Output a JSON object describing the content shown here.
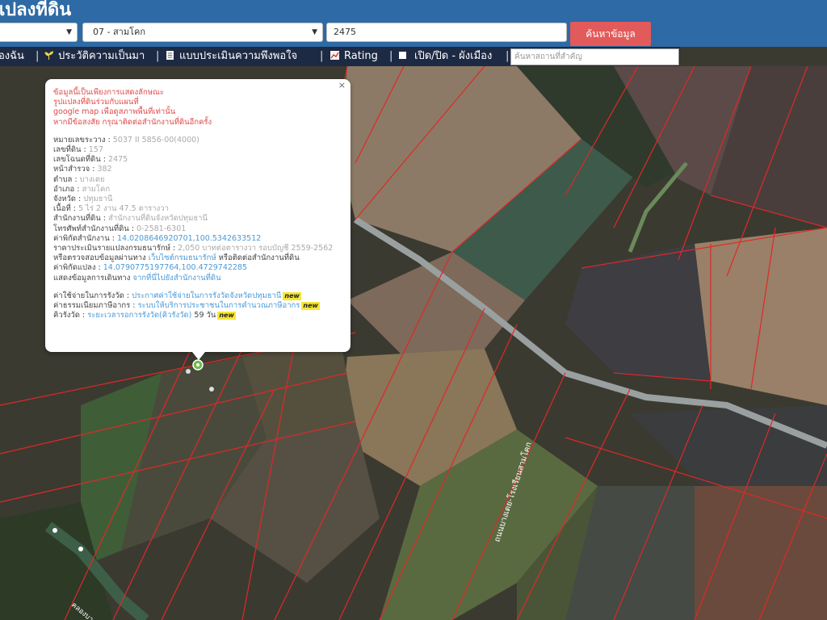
{
  "header": {
    "title": "แปลงที่ดิน",
    "province_select": {
      "value": ""
    },
    "district_select": {
      "value": "07 - สามโคก"
    },
    "parcel_input": {
      "value": "2475"
    },
    "search_button": {
      "label": "ค้นหาข้อมูล"
    }
  },
  "toolbar": {
    "items": [
      {
        "label": "องฉัน"
      },
      {
        "label": "ประวัติความเป็นมา",
        "icon": "sprout-icon"
      },
      {
        "label": "แบบประเมินความพึงพอใจ",
        "icon": "document-icon"
      },
      {
        "label": "Rating",
        "icon": "chart-icon"
      },
      {
        "label": "เปิด/ปิด - ผังเมือง",
        "icon": "checkbox-icon"
      }
    ],
    "place_search": {
      "placeholder": "ค้นหาสถานที่สำคัญ"
    }
  },
  "popup": {
    "notice": [
      "ข้อมูลนี้เป็นเพียงการแสดงลักษณะ",
      "รูปแปลงที่ดินร่วมกับแผนที่",
      "google map เพื่อดูสภาพพื้นที่เท่านั้น",
      "หากมีข้อสงสัย กรุณาติดต่อสำนักงานที่ดินอีกครั้ง"
    ],
    "fields": [
      {
        "label": "หมายเลขระวาง",
        "value": "5037 II 5856-00(4000)"
      },
      {
        "label": "เลขที่ดิน",
        "value": "157"
      },
      {
        "label": "เลขโฉนดที่ดิน",
        "value": "2475"
      },
      {
        "label": "หน้าสำรวจ",
        "value": "382"
      },
      {
        "label": "ตำบล",
        "value": "บางเตย"
      },
      {
        "label": "อำเภอ",
        "value": "สามโคก"
      },
      {
        "label": "จังหวัด",
        "value": "ปทุมธานี"
      },
      {
        "label": "เนื้อที่",
        "value": "5 ไร่ 2 งาน 47.5 ตารางวา"
      },
      {
        "label": "สำนักงานที่ดิน",
        "value": "สำนักงานที่ดินจังหวัดปทุมธานี"
      },
      {
        "label": "โทรศัพท์สำนักงานที่ดิน",
        "value": "0-2581-6301"
      },
      {
        "label": "ค่าพิกัดสำนักงาน",
        "value": "14.0208646920701,100.5342633512"
      }
    ],
    "appraisal_label": "ราคาประเมินรายแปลงกรมธนารักษ์",
    "appraisal_value": "2,050 บาทต่อตารางวา รอบบัญชี 2559-2562",
    "verify_prefix": "หรือตรวจสอบข้อมูลผ่านทาง",
    "verify_link": "เว็บไซต์กรมธนารักษ์",
    "verify_suffix": "หรือติดต่อสำนักงานที่ดิน",
    "parcel_coord_label": "ค่าพิกัดแปลง",
    "parcel_coord_value": "14.0790775197764,100.4729742285",
    "route_label": "แสดงข้อมูลการเดินทาง",
    "route_link": "จากที่นี่ไปยังสำนักงานที่ดิน",
    "fee_label": "ค่าใช้จ่ายในการรังวัด",
    "fee_link": "ประกาศค่าใช้จ่ายในการรังวัดจังหวัดปทุมธานี",
    "tax_label": "ค่าธรรมเนียมภาษีอากร",
    "tax_link": "ระบบให้บริการประชาชนในการคำนวณภาษีอากร",
    "survey_label": "คิวรังวัด",
    "survey_link": "ระยะเวลารอการรังวัด(คิวรังวัด)",
    "survey_value": "59 วัน",
    "new_badge": "new",
    "close_glyph": "×"
  },
  "map": {
    "road_label": "ถนนบางเตย-โรงเรียนสามโคก",
    "road_label_2": "คลองบางเตย"
  },
  "colors": {
    "header": "#2e6aa5",
    "toolbar": "#1d2a44",
    "search_button": "#e35a5a",
    "parcel_lines": "#e02828",
    "road": "#9aa0a0"
  }
}
